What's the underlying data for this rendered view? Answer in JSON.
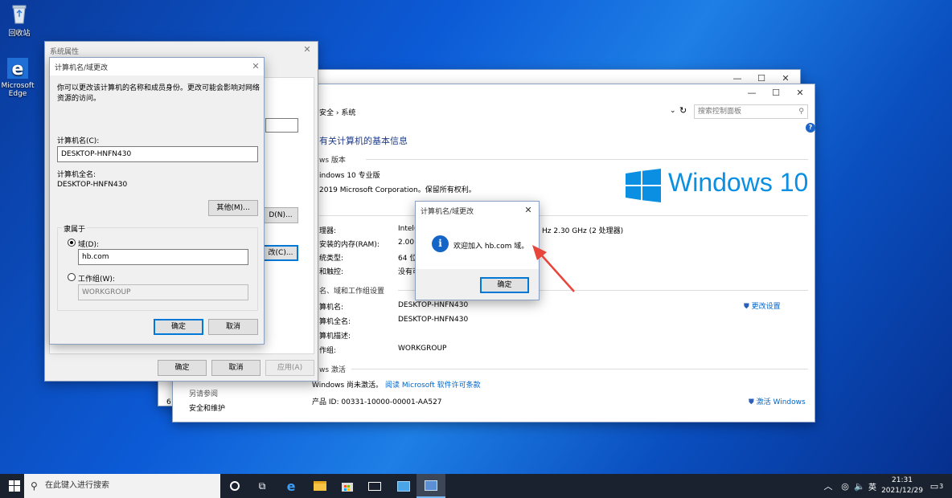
{
  "desktop": {
    "recycle_bin_label": "回收站",
    "edge_label_1": "Microsoft",
    "edge_label_2": "Edge"
  },
  "system_window": {
    "breadcrumb_part": "安全",
    "breadcrumb_current": "系统",
    "search_placeholder": "搜索控制面板",
    "heading": "有关计算机的基本信息",
    "edition_section": "ws 版本",
    "edition": "indows 10 专业版",
    "copyright": "2019 Microsoft Corporation。保留所有权利。",
    "logo_text": "Windows 10",
    "system_rows": [
      {
        "label": "理器:",
        "value": "Intel(R"
      },
      {
        "label": "安装的内存(RAM):",
        "value": "2.00 G"
      },
      {
        "label": "统类型:",
        "value": "64 位"
      },
      {
        "label": "和触控:",
        "value": "没有可"
      }
    ],
    "processor_tail": "Hz   2.30 GHz  (2 处理器)",
    "name_section": "名、域和工作组设置",
    "name_rows": [
      {
        "label": "算机名:",
        "value": "DESKTOP-HNFN430"
      },
      {
        "label": "算机全名:",
        "value": "DESKTOP-HNFN430"
      },
      {
        "label": "算机描述:",
        "value": ""
      },
      {
        "label": "作组:",
        "value": "WORKGROUP"
      }
    ],
    "change_settings": "更改设置",
    "activation_section": "ws 激活",
    "activation_status": "Windows 尚未激活。",
    "license_link": "阅读 Microsoft 软件许可条款",
    "product_id": "产品 ID: 00331-10000-00001-AA527",
    "activate_link": "激活 Windows",
    "see_also": "另请参阅",
    "security_link": "安全和维护",
    "back_window_digit": "6"
  },
  "sys_props": {
    "title": "系统属性",
    "btn_d": "D(N)...",
    "btn_c": "改(C)...",
    "ok": "确定",
    "cancel": "取消",
    "apply": "应用(A)"
  },
  "name_change": {
    "title": "计算机名/域更改",
    "description": "你可以更改该计算机的名称和成员身份。更改可能会影响对网络资源的访问。",
    "computer_name_label": "计算机名(C):",
    "computer_name_value": "DESKTOP-HNFN430",
    "full_name_label": "计算机全名:",
    "full_name_value": "DESKTOP-HNFN430",
    "more_button": "其他(M)...",
    "member_of": "隶属于",
    "domain_label": "域(D):",
    "domain_value": "hb.com",
    "workgroup_label": "工作组(W):",
    "workgroup_value": "WORKGROUP",
    "ok": "确定",
    "cancel": "取消"
  },
  "welcome_dialog": {
    "title": "计算机名/域更改",
    "message": "欢迎加入 hb.com 域。",
    "ok": "确定"
  },
  "taskbar": {
    "search_placeholder": "在此键入进行搜索",
    "ime": "英",
    "time": "21:31",
    "date": "2021/12/29",
    "notification_count": "3"
  },
  "colors": {
    "arrow": "#e8453c",
    "link": "#0066cc",
    "accent": "#0078d7",
    "heading": "#1e3c8c"
  }
}
